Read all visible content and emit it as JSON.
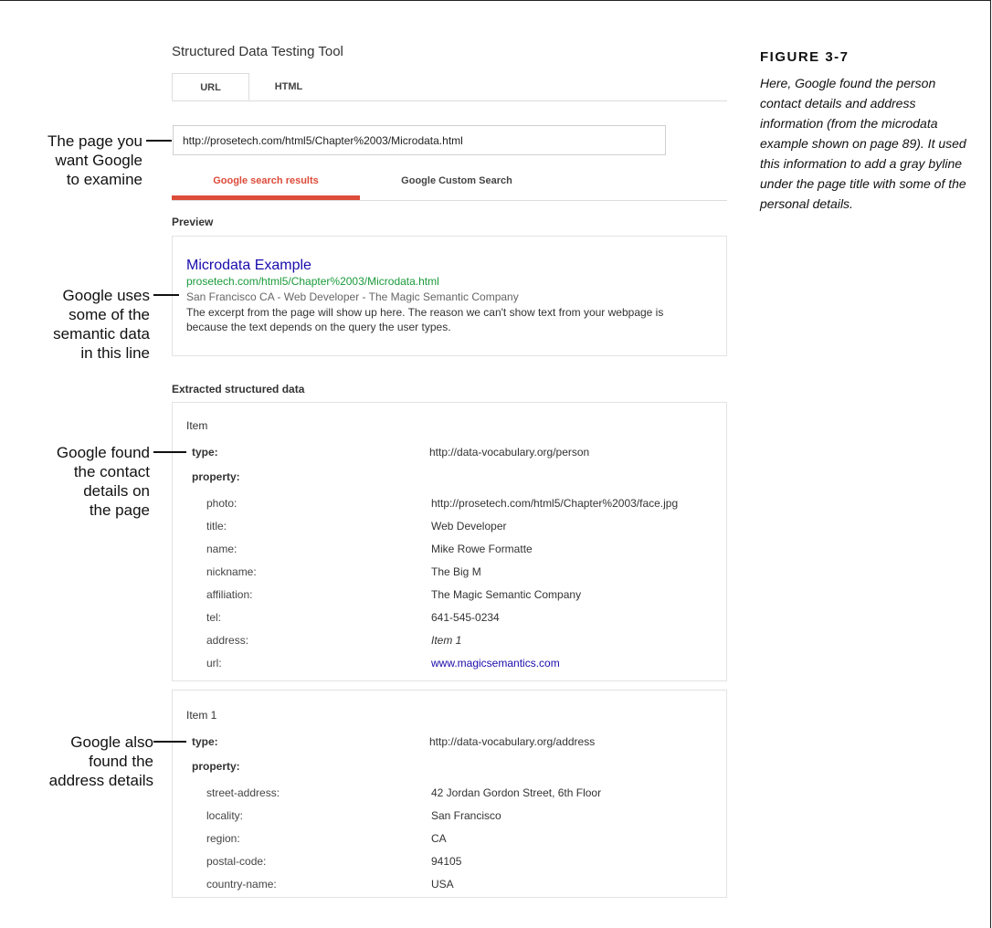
{
  "tool": {
    "title": "Structured Data Testing Tool",
    "tabs": [
      {
        "label": "URL",
        "active": true
      },
      {
        "label": "HTML",
        "active": false
      }
    ],
    "url_value": "http://prosetech.com/html5/Chapter%2003/Microdata.html",
    "result_tabs": [
      {
        "label": "Google search results",
        "active": true
      },
      {
        "label": "Google Custom Search",
        "active": false
      }
    ],
    "accent_color": "#dd4b39"
  },
  "preview": {
    "heading": "Preview",
    "snippet": {
      "title": "Microdata Example",
      "url": "prosetech.com/html5/Chapter%2003/Microdata.html",
      "byline": "San Francisco CA - Web Developer - The Magic Semantic Company",
      "text": "The excerpt from the page will show up here. The reason we can't show text from your webpage is because the text depends on the query the user types."
    }
  },
  "extracted": {
    "heading": "Extracted structured data",
    "items": [
      {
        "title": "Item",
        "type_label": "type:",
        "type_value": "http://data-vocabulary.org/person",
        "property_label": "property:",
        "properties": [
          {
            "key": "photo:",
            "value": "http://prosetech.com/html5/Chapter%2003/face.jpg"
          },
          {
            "key": "title:",
            "value": "Web Developer"
          },
          {
            "key": "name:",
            "value": "Mike Rowe Formatte"
          },
          {
            "key": "nickname:",
            "value": "The Big M"
          },
          {
            "key": "affiliation:",
            "value": "The Magic Semantic Company"
          },
          {
            "key": "tel:",
            "value": "641-545-0234"
          },
          {
            "key": "address:",
            "value": "Item 1"
          },
          {
            "key": "url:",
            "value": "www.magicsemantics.com"
          }
        ]
      },
      {
        "title": "Item 1",
        "type_label": "type:",
        "type_value": "http://data-vocabulary.org/address",
        "property_label": "property:",
        "properties": [
          {
            "key": "street-address:",
            "value": "42 Jordan Gordon Street, 6th Floor"
          },
          {
            "key": "locality:",
            "value": "San Francisco"
          },
          {
            "key": "region:",
            "value": "CA"
          },
          {
            "key": "postal-code:",
            "value": "94105"
          },
          {
            "key": "country-name:",
            "value": "USA"
          }
        ]
      }
    ]
  },
  "callouts": {
    "page": [
      "The page you",
      "want Google",
      "to examine"
    ],
    "semantic": [
      "Google uses",
      "some of the",
      "semantic data",
      "in this line"
    ],
    "contact": [
      "Google found",
      "the contact",
      "details on",
      "the page"
    ],
    "address": [
      "Google also",
      "found the",
      "address details"
    ]
  },
  "figure": {
    "label": "FIGURE 3-7",
    "caption": "Here, Google found the person contact details and address information (from the microdata example shown on page 89). It used this information to add a gray byline under the page title with some of the personal details."
  }
}
